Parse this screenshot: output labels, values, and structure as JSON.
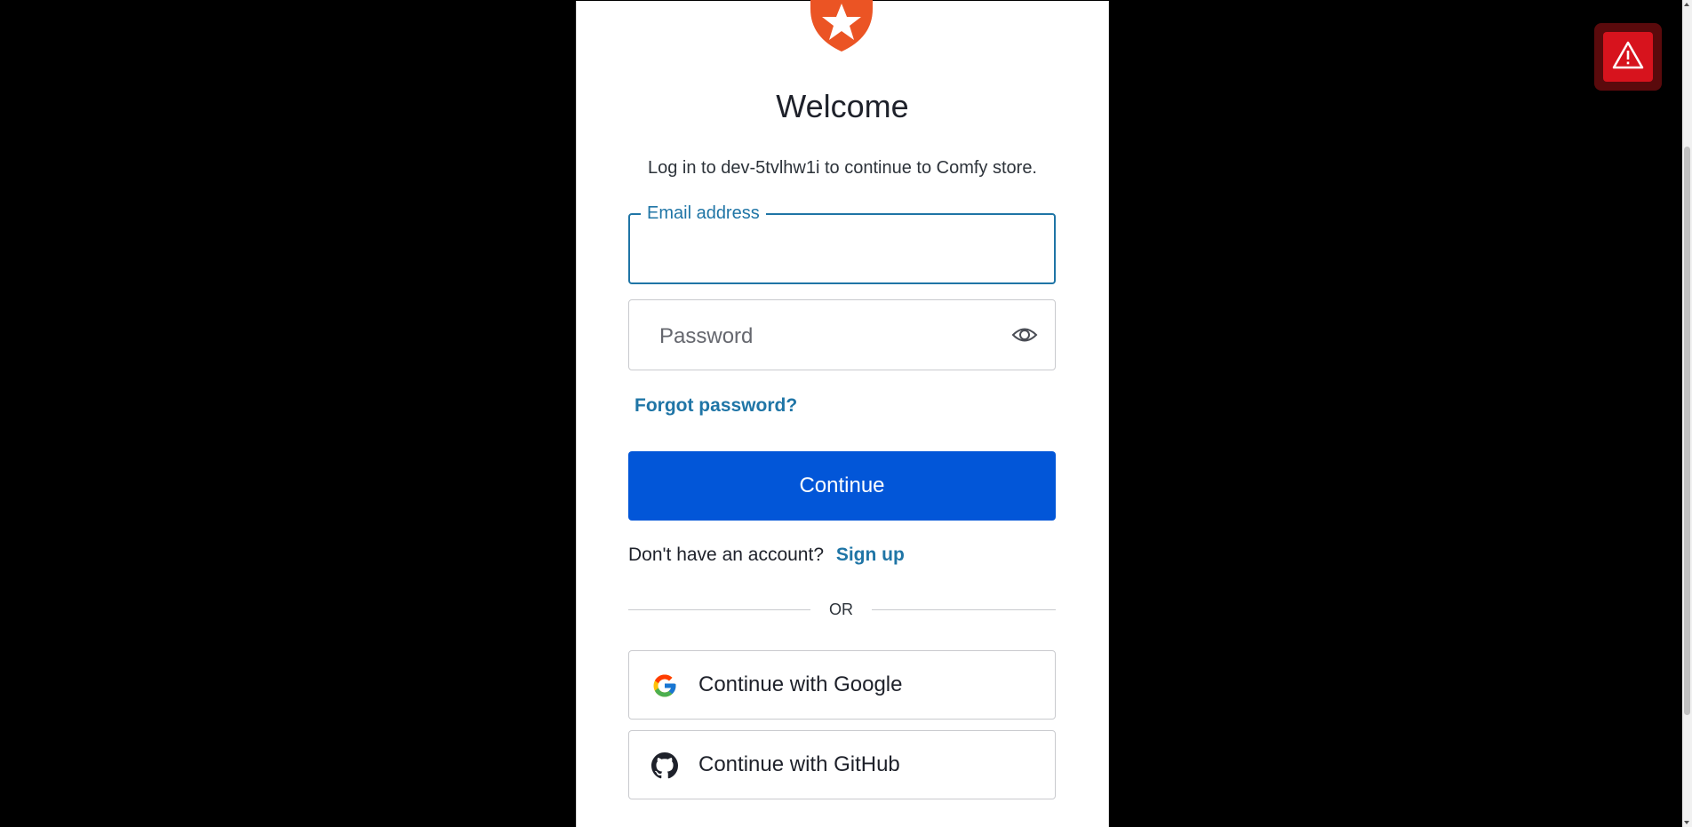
{
  "login": {
    "title": "Welcome",
    "subtitle": "Log in to dev-5tvlhw1i to continue to Comfy store.",
    "email_label": "Email address",
    "email_value": "",
    "password_placeholder": "Password",
    "forgot_password": "Forgot password?",
    "continue_label": "Continue",
    "no_account_text": "Don't have an account?",
    "signup_label": "Sign up",
    "divider_text": "OR",
    "google_label": "Continue with Google",
    "github_label": "Continue with GitHub"
  },
  "icons": {
    "logo": "star-shield-logo",
    "password_toggle": "eye-icon",
    "google": "google-icon",
    "github": "github-icon",
    "alert": "warning-icon"
  },
  "colors": {
    "background": "#000000",
    "card": "#ffffff",
    "brand_logo": "#eb5424",
    "primary_button": "#0256d8",
    "link": "#1f75a6",
    "alert_badge": "#d7131d"
  }
}
